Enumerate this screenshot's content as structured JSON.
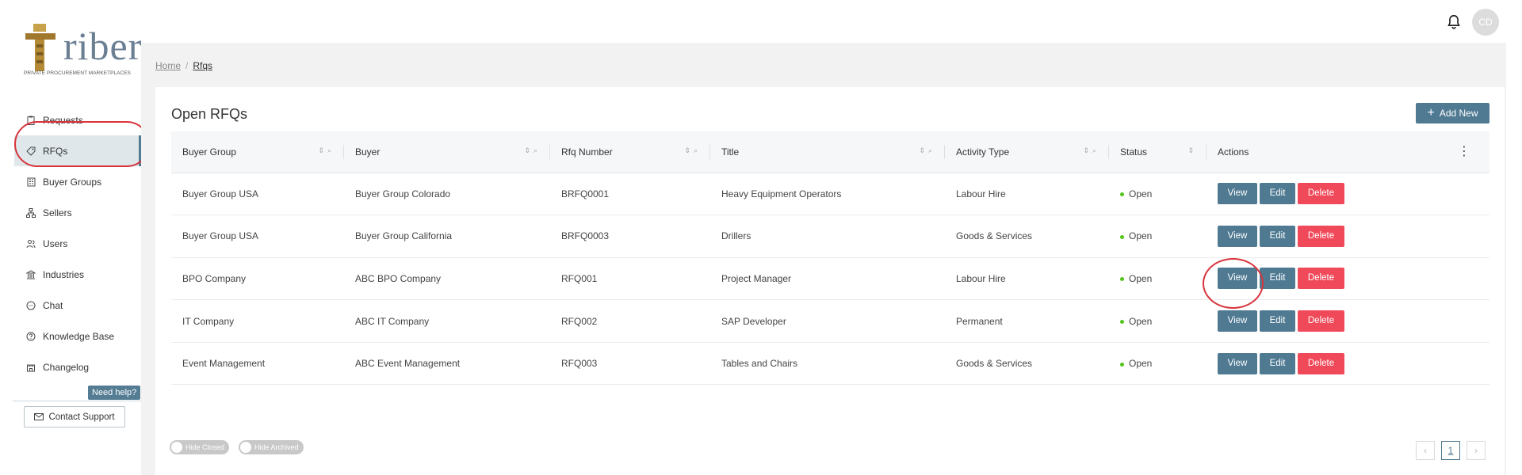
{
  "logo": {
    "word": "riber",
    "tagline": "PRIVATE PROCUREMENT MARKETPLACES",
    "totem_letters": "ICE"
  },
  "header": {
    "avatar_initials": "CD",
    "bell_icon": "bell-icon"
  },
  "sidebar": {
    "items": [
      {
        "label": "Requests",
        "icon": "clipboard-icon"
      },
      {
        "label": "RFQs",
        "icon": "tag-icon",
        "active": true
      },
      {
        "label": "Buyer Groups",
        "icon": "building-icon"
      },
      {
        "label": "Sellers",
        "icon": "sitemap-icon"
      },
      {
        "label": "Users",
        "icon": "users-icon"
      },
      {
        "label": "Industries",
        "icon": "bank-icon"
      },
      {
        "label": "Chat",
        "icon": "chat-icon"
      },
      {
        "label": "Knowledge Base",
        "icon": "question-icon"
      },
      {
        "label": "Changelog",
        "icon": "castle-icon"
      }
    ],
    "need_help": "Need help?",
    "contact_support": "Contact Support"
  },
  "breadcrumb": {
    "home": "Home",
    "separator": "/",
    "current": "Rfqs"
  },
  "page": {
    "title": "Open RFQs",
    "add_new_label": "Add New"
  },
  "table": {
    "columns": [
      "Buyer Group",
      "Buyer",
      "Rfq Number",
      "Title",
      "Activity Type",
      "Status",
      "Actions"
    ],
    "rows": [
      {
        "buyer_group": "Buyer Group USA",
        "buyer": "Buyer Group Colorado",
        "rfq_number": "BRFQ0001",
        "title": "Heavy Equipment Operators",
        "activity_type": "Labour Hire",
        "status": "Open"
      },
      {
        "buyer_group": "Buyer Group USA",
        "buyer": "Buyer Group California",
        "rfq_number": "BRFQ0003",
        "title": "Drillers",
        "activity_type": "Goods & Services",
        "status": "Open"
      },
      {
        "buyer_group": "BPO Company",
        "buyer": "ABC BPO Company",
        "rfq_number": "RFQ001",
        "title": "Project Manager",
        "activity_type": "Labour Hire",
        "status": "Open"
      },
      {
        "buyer_group": "IT Company",
        "buyer": "ABC IT Company",
        "rfq_number": "RFQ002",
        "title": "SAP Developer",
        "activity_type": "Permanent",
        "status": "Open"
      },
      {
        "buyer_group": "Event Management",
        "buyer": "ABC Event Management",
        "rfq_number": "RFQ003",
        "title": "Tables and Chairs",
        "activity_type": "Goods & Services",
        "status": "Open"
      }
    ],
    "actions": {
      "view": "View",
      "edit": "Edit",
      "delete": "Delete"
    }
  },
  "pagination": {
    "prev": "‹",
    "current_page": "1",
    "next": "›"
  },
  "toggles": {
    "hide_closed": "Hide Closed",
    "hide_archived": "Hide Archived"
  },
  "colors": {
    "primary": "#4f7a92",
    "danger": "#f04a5a",
    "status_open": "#52c41a",
    "highlight_circle": "#d8343c"
  }
}
